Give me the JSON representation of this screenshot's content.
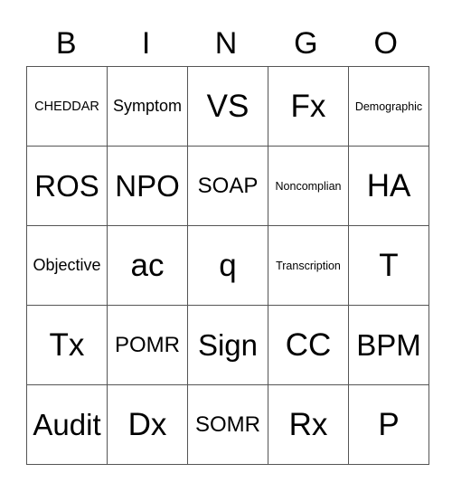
{
  "header": [
    "B",
    "I",
    "N",
    "G",
    "O"
  ],
  "rows": [
    [
      "CHEDDAR",
      "Symptom",
      "VS",
      "Fx",
      "Demographic"
    ],
    [
      "ROS",
      "NPO",
      "SOAP",
      "Noncomplian",
      "HA"
    ],
    [
      "Objective",
      "ac",
      "q",
      "Transcription",
      "T"
    ],
    [
      "Tx",
      "POMR",
      "Sign",
      "CC",
      "BPM"
    ],
    [
      "Audit",
      "Dx",
      "SOMR",
      "Rx",
      "P"
    ]
  ]
}
